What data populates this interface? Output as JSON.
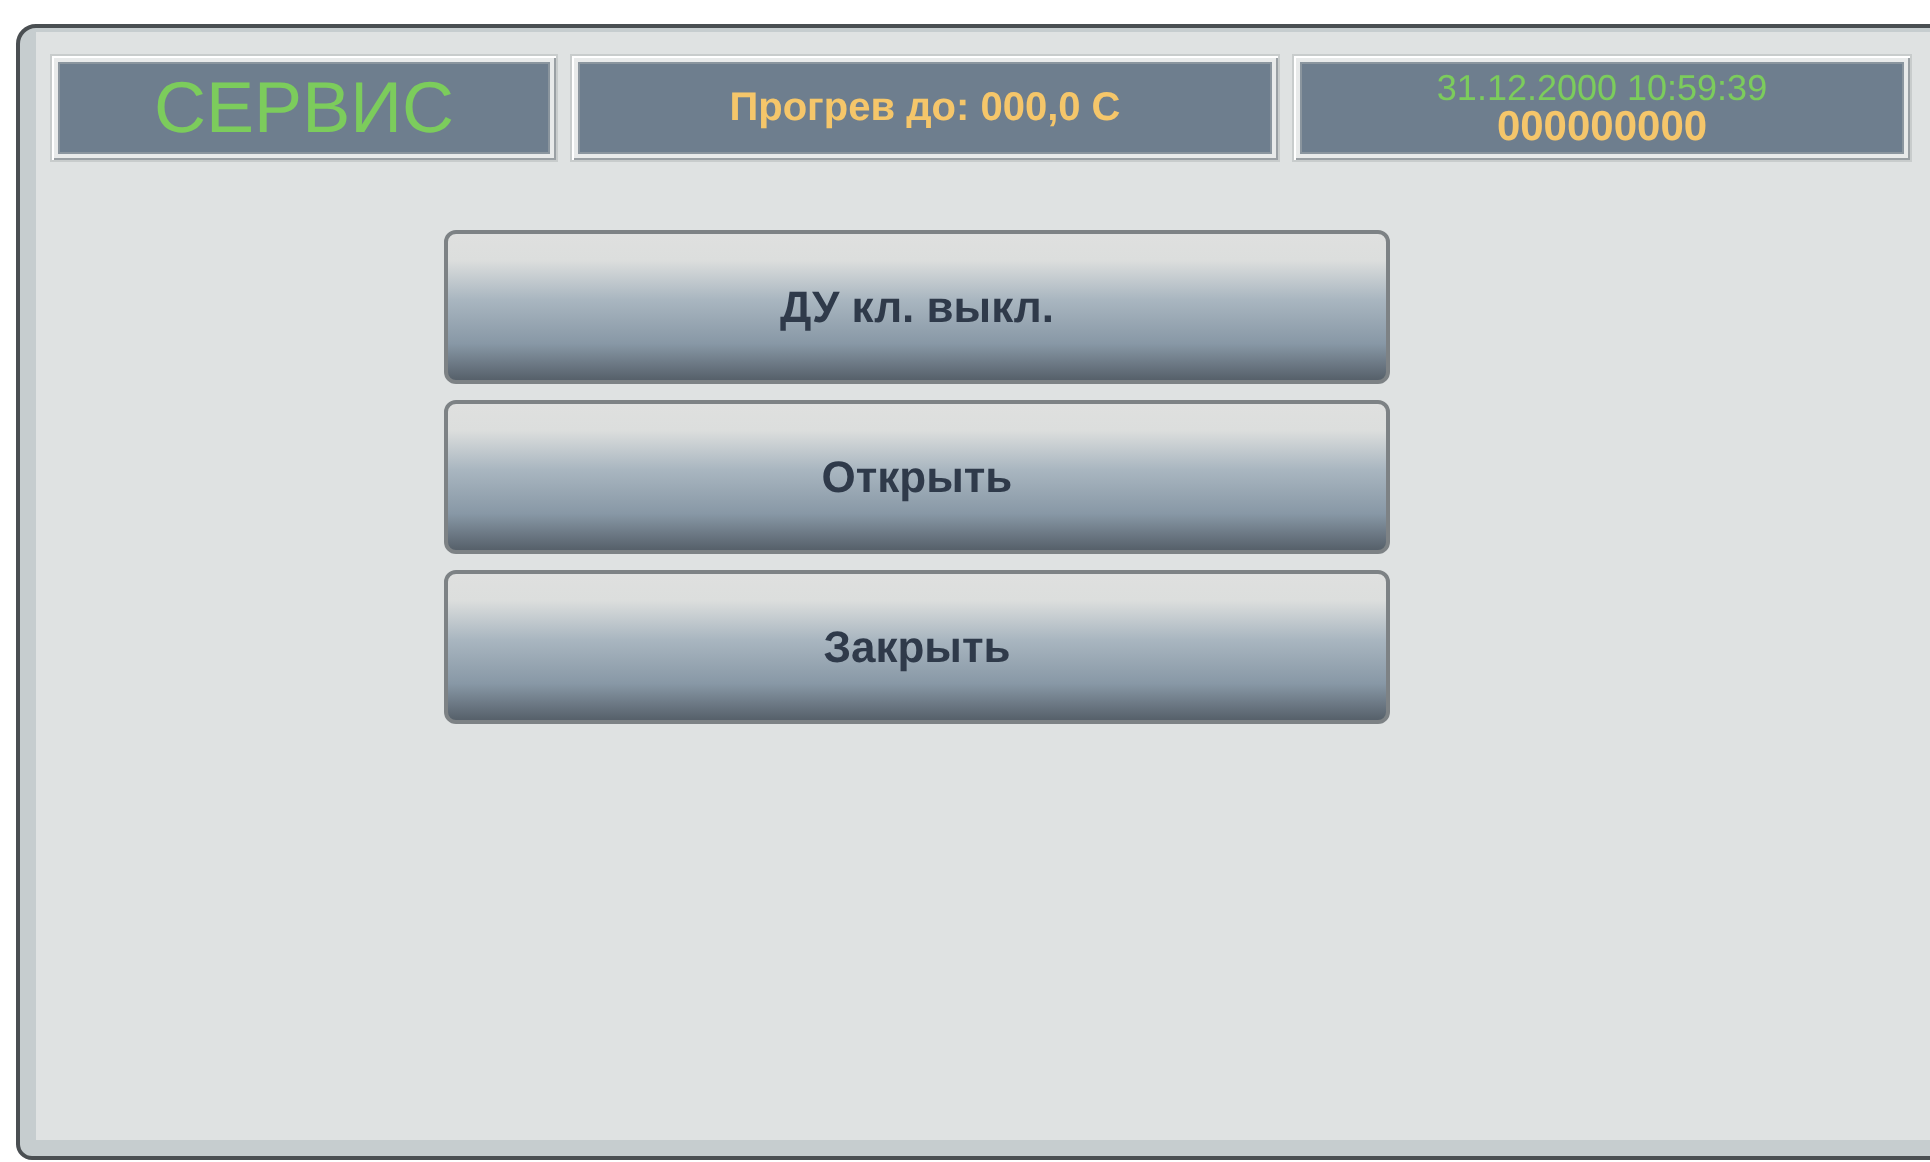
{
  "header": {
    "mode": "СЕРВИС",
    "warmup": "Прогрев до: 000,0 С",
    "datetime": "31.12.2000 10:59:39",
    "counter": "000000000"
  },
  "buttons": [
    {
      "label": "ДУ кл. выкл."
    },
    {
      "label": "Открыть"
    },
    {
      "label": "Закрыть"
    }
  ]
}
